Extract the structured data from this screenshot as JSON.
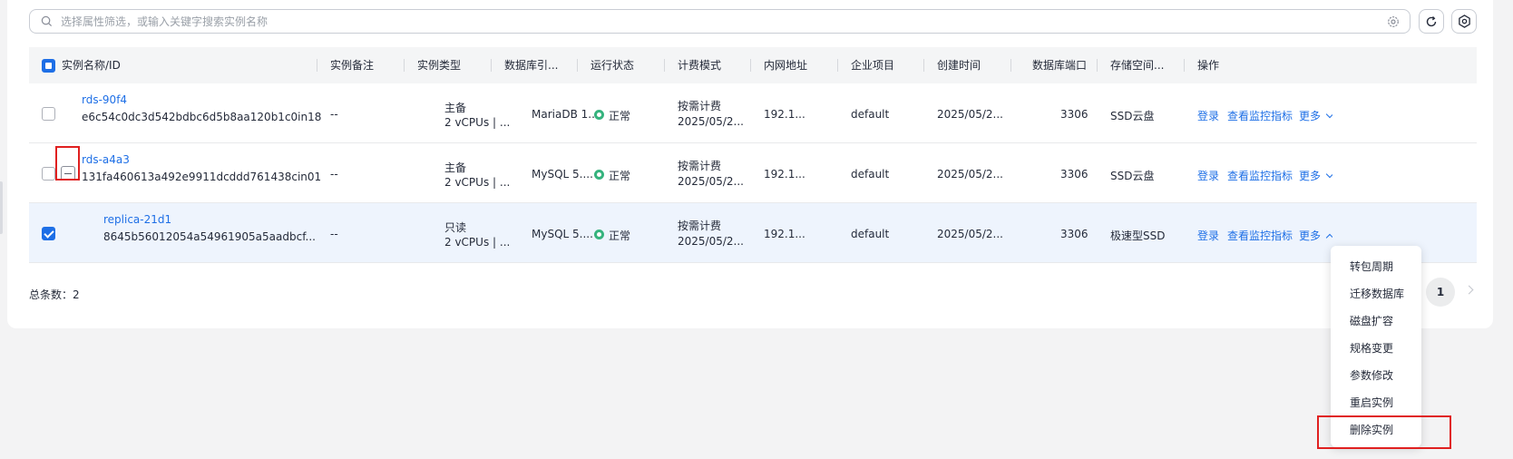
{
  "search": {
    "placeholder": "选择属性筛选，或输入关键字搜索实例名称"
  },
  "toolbar": {
    "refresh_icon": "refresh-icon",
    "settings_icon": "gear-icon"
  },
  "columns": [
    "实例名称/ID",
    "实例备注",
    "实例类型",
    "数据库引...",
    "运行状态",
    "计费模式",
    "内网地址",
    "企业项目",
    "创建时间",
    "数据库端口",
    "存储空间...",
    "操作"
  ],
  "rows": [
    {
      "name": "rds-90f4",
      "id": "e6c54c0dc3d542bdbc6d5b8aa120b1c0in18",
      "remark": "--",
      "type_line1": "主备",
      "type_line2": "2 vCPUs | ...",
      "engine": "MariaDB 1...",
      "status": "正常",
      "billing_line1": "按需计费",
      "billing_line2": "2025/05/2...",
      "ip": "192.1...",
      "project": "default",
      "created": "2025/05/2...",
      "port": "3306",
      "storage": "SSD云盘",
      "op_login": "登录",
      "op_monitor": "查看监控指标",
      "op_more": "更多",
      "checked": false
    },
    {
      "name": "rds-a4a3",
      "id": "131fa460613a492e9911dcddd761438cin01",
      "remark": "--",
      "type_line1": "主备",
      "type_line2": "2 vCPUs | ...",
      "engine": "MySQL 5....",
      "status": "正常",
      "billing_line1": "按需计费",
      "billing_line2": "2025/05/2...",
      "ip": "192.1...",
      "project": "default",
      "created": "2025/05/2...",
      "port": "3306",
      "storage": "SSD云盘",
      "op_login": "登录",
      "op_monitor": "查看监控指标",
      "op_more": "更多",
      "checked": false
    },
    {
      "name": "replica-21d1",
      "id": "8645b56012054a54961905a5aadbcf...",
      "remark": "--",
      "type_line1": "只读",
      "type_line2": "2 vCPUs | ...",
      "engine": "MySQL 5....",
      "status": "正常",
      "billing_line1": "按需计费",
      "billing_line2": "2025/05/2...",
      "ip": "192.1...",
      "project": "default",
      "created": "2025/05/2...",
      "port": "3306",
      "storage": "极速型SSD",
      "op_login": "登录",
      "op_monitor": "查看监控指标",
      "op_more": "更多",
      "checked": true
    }
  ],
  "footer": {
    "total_label": "总条数：2",
    "current_page": "1"
  },
  "more_menu": [
    "转包周期",
    "迁移数据库",
    "磁盘扩容",
    "规格变更",
    "参数修改",
    "重启实例",
    "删除实例"
  ],
  "colors": {
    "accent": "#1e6fe6",
    "status_ok": "#36b37e",
    "highlight": "#e02020",
    "selected_row": "#eef4fd"
  }
}
